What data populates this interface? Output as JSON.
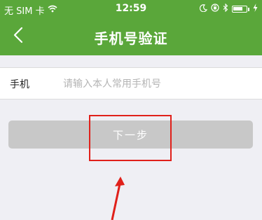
{
  "status_bar": {
    "carrier": "无 SIM 卡",
    "time": "12:59"
  },
  "nav": {
    "title": "手机号验证"
  },
  "phone_input": {
    "label": "手机",
    "placeholder": "请输入本人常用手机号",
    "value": ""
  },
  "next_button": {
    "label": "下一步"
  },
  "colors": {
    "header_green": "#5aa73a",
    "button_disabled": "#c8c8c8",
    "annotation_red": "#e0201a"
  }
}
